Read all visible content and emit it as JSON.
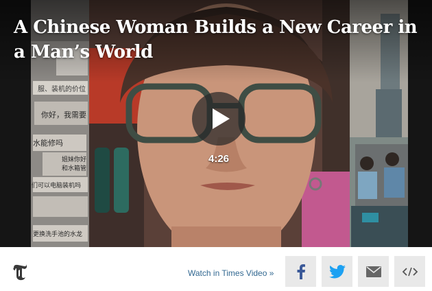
{
  "video": {
    "title": "A Chinese Woman Builds a New Career in a Man’s World",
    "duration": "4:26",
    "background_text": {
      "left_panel": [
        "服、装机的价位",
        "你好，我需要",
        "水能修吗",
        "姐妹你好",
        "和水箱管",
        "们可以电脑装机吗",
        "更换洗手池的水龙"
      ]
    },
    "colors": {
      "accent": "#326891",
      "icon": "#326891"
    }
  },
  "toolbar": {
    "logo_icon": "nyt-t-logo-icon",
    "watch_label": "Watch in Times Video »",
    "share": [
      {
        "name": "facebook",
        "icon": "facebook-icon"
      },
      {
        "name": "twitter",
        "icon": "twitter-icon"
      },
      {
        "name": "email",
        "icon": "email-icon"
      },
      {
        "name": "embed",
        "icon": "embed-code-icon"
      }
    ]
  }
}
